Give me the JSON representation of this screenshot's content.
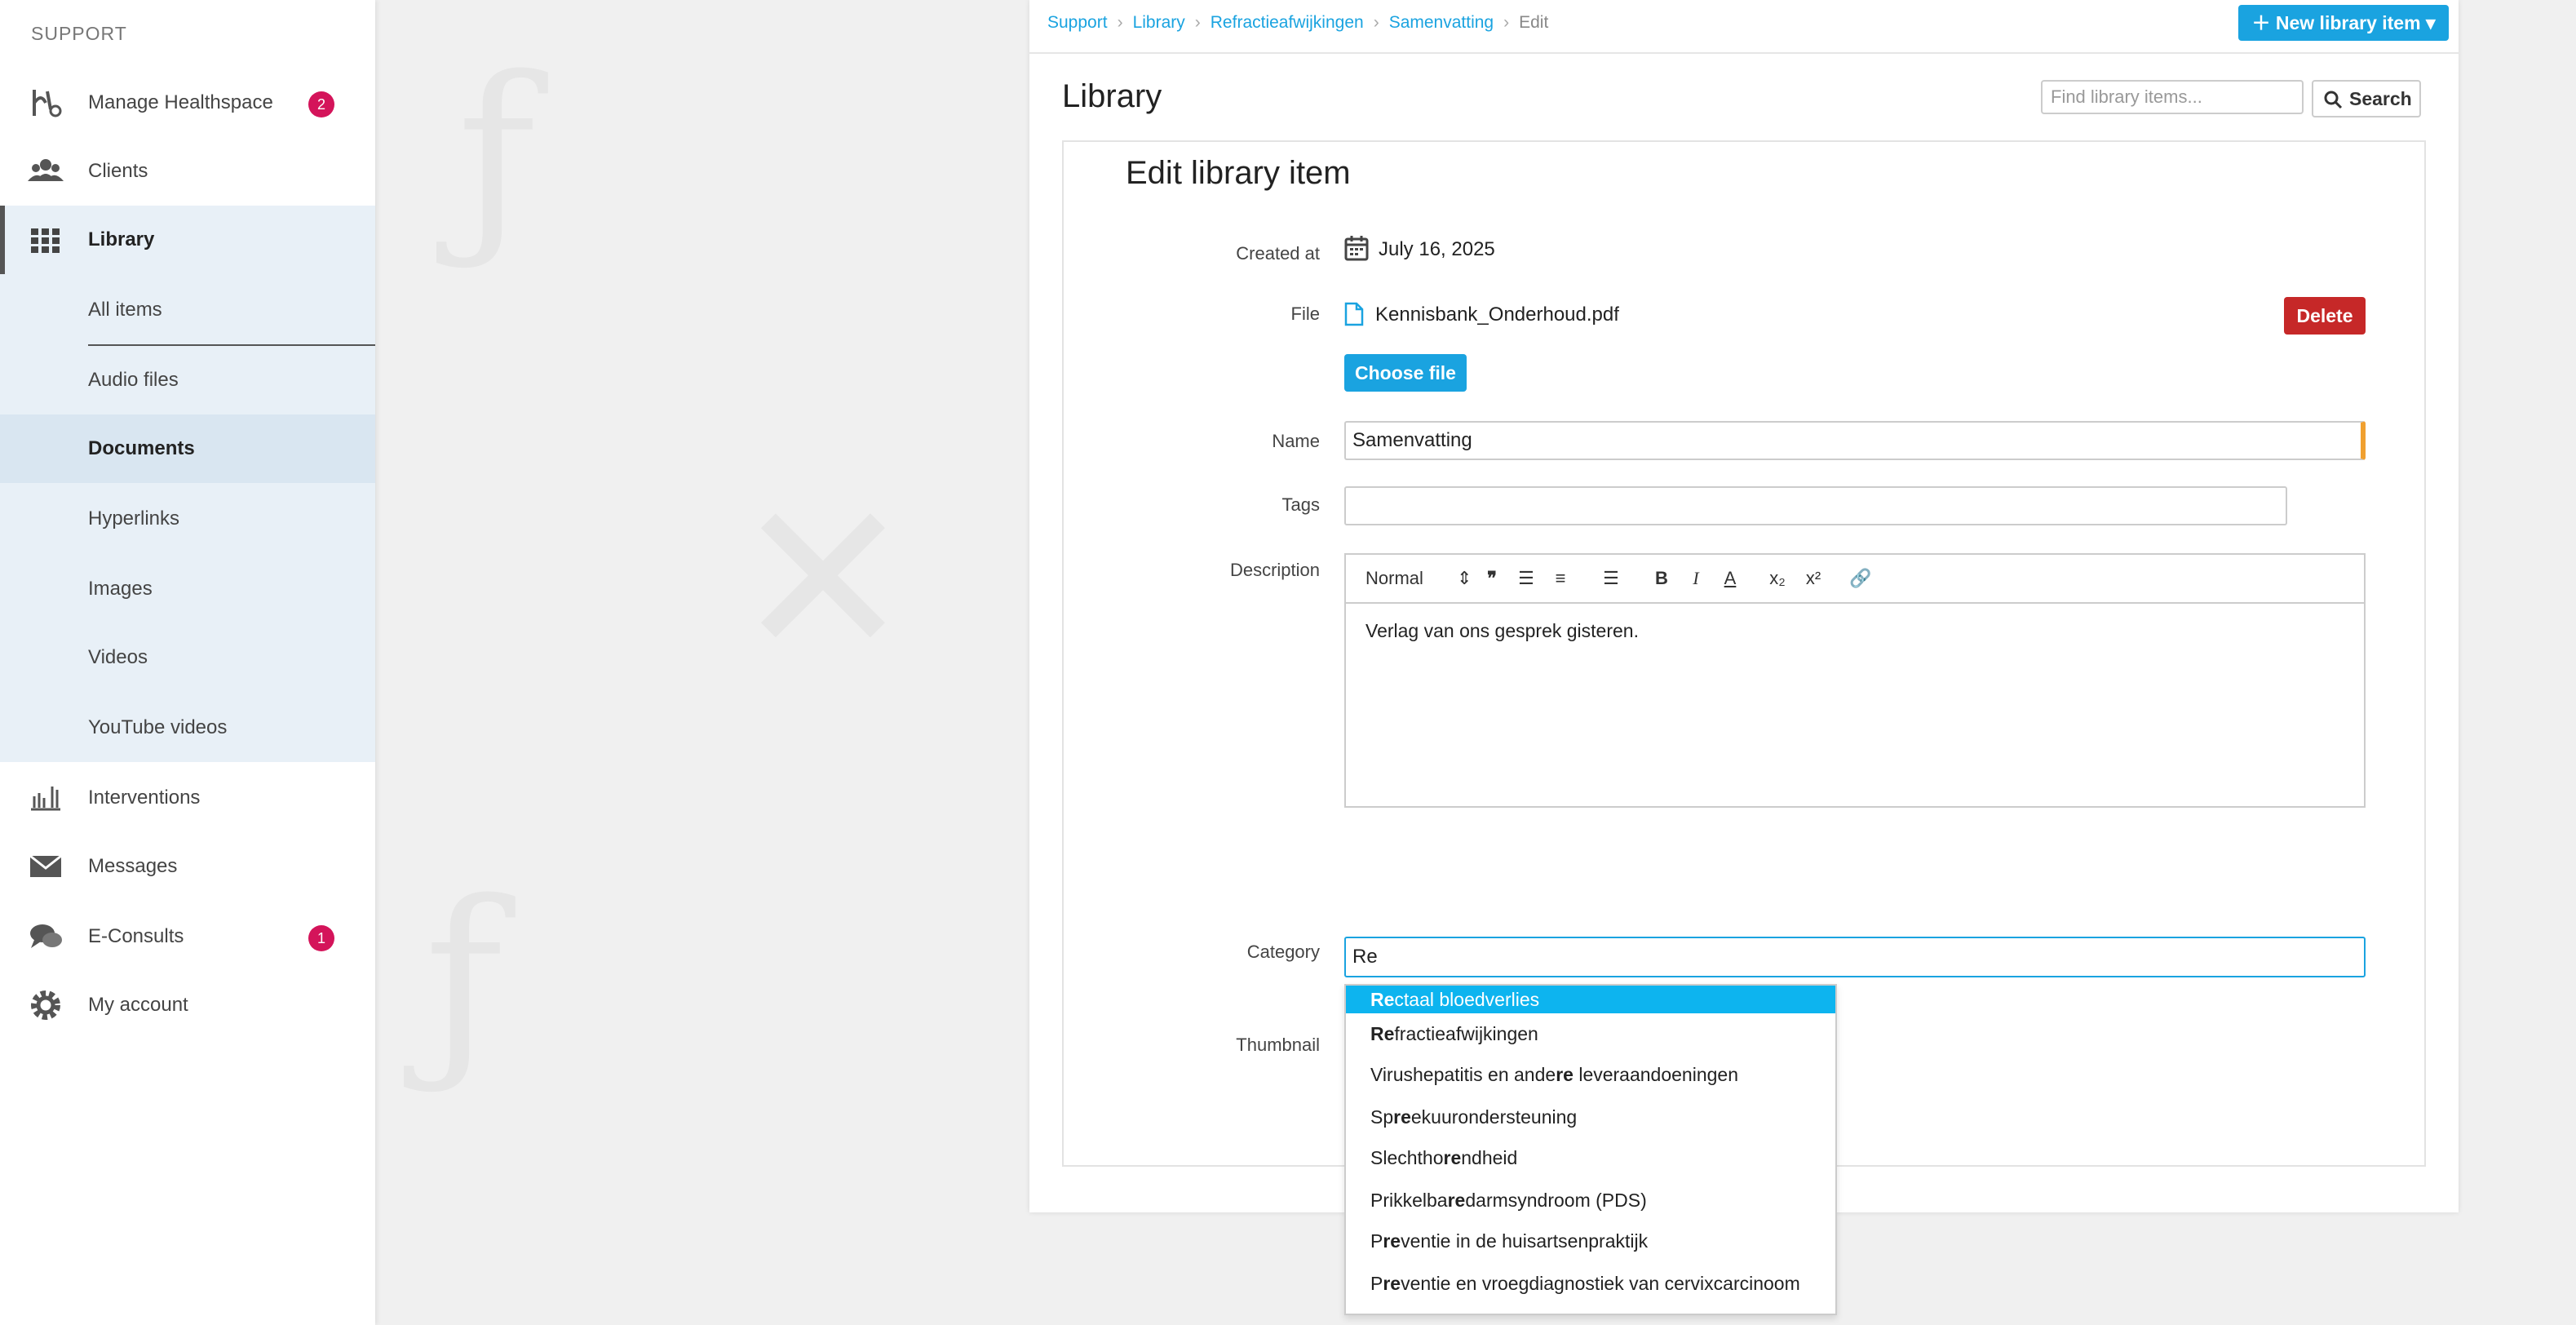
{
  "sidebar": {
    "header": "SUPPORT",
    "items": [
      {
        "label": "Manage Healthspace",
        "icon": "healthspace-icon",
        "badge": "2"
      },
      {
        "label": "Clients",
        "icon": "clients-icon"
      },
      {
        "label": "Library",
        "icon": "library-grid-icon"
      },
      {
        "label": "Interventions",
        "icon": "interventions-icon"
      },
      {
        "label": "Messages",
        "icon": "envelope-icon"
      },
      {
        "label": "E-Consults",
        "icon": "chat-icon",
        "badge": "1"
      },
      {
        "label": "My account",
        "icon": "gear-icon"
      }
    ],
    "library_sub": [
      "All items",
      "Audio files",
      "Documents",
      "Hyperlinks",
      "Images",
      "Videos",
      "YouTube videos"
    ]
  },
  "breadcrumb": [
    "Support",
    "Library",
    "Refractieafwijkingen",
    "Samenvatting",
    "Edit"
  ],
  "new_button": "New library item",
  "page_title": "Library",
  "search": {
    "placeholder": "Find library items...",
    "button": "Search"
  },
  "form": {
    "title": "Edit library item",
    "created_label": "Created at",
    "created_value": "July 16, 2025",
    "file_label": "File",
    "file_name": "Kennisbank_Onderhoud.pdf",
    "delete_label": "Delete",
    "choose_label": "Choose file",
    "name_label": "Name",
    "name_value": "Samenvatting",
    "tags_label": "Tags",
    "tags_value": "",
    "description_label": "Description",
    "toolbar_format": "Normal",
    "description_text": "Verlag van ons gesprek gisteren.",
    "category_label": "Category",
    "category_value": "Re",
    "thumbnail_label": "Thumbnail"
  },
  "dropdown": [
    {
      "pre": "",
      "match": "Re",
      "post": "ctaal bloedverlies"
    },
    {
      "pre": "",
      "match": "Re",
      "post": "fractieafwijkingen"
    },
    {
      "pre": "Virushepatitis en ande",
      "match": "re",
      "post": " leveraandoeningen"
    },
    {
      "pre": "Sp",
      "match": "re",
      "post": "ekuurondersteuning"
    },
    {
      "pre": "Slechtho",
      "match": "re",
      "post": "ndheid"
    },
    {
      "pre": "Prikkelba",
      "match": "re",
      "post": "darmsyndroom (PDS)"
    },
    {
      "pre": "P",
      "match": "re",
      "post": "ventie in de huisartsenpraktijk"
    },
    {
      "pre": "P",
      "match": "re",
      "post": "ventie en vroegdiagnostiek van cervixcarcinoom"
    }
  ],
  "colors": {
    "accent": "#1aa3e0",
    "danger": "#c62828",
    "badge": "#d4145a",
    "highlight": "#0db4ef"
  }
}
